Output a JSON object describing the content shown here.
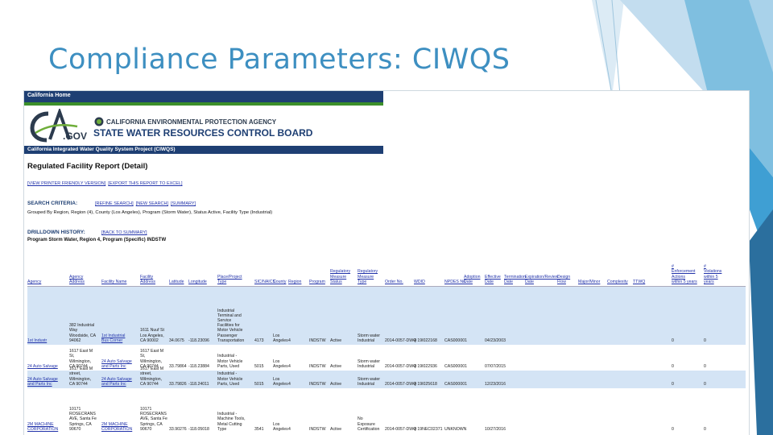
{
  "slide": {
    "title": "Compliance Parameters: CIWQS"
  },
  "site": {
    "home_bar": "California Home",
    "logo_text": "CA.GOV",
    "agency": "CALIFORNIA ENVIRONMENTAL PROTECTION AGENCY",
    "board": "STATE WATER RESOURCES CONTROL BOARD",
    "project_bar": "California Integrated Water Quality System Project (CIWQS)"
  },
  "report": {
    "title": "Regulated Facility Report (Detail)",
    "links": [
      "[VIEW PRINTER FRIENDLY VERSION]",
      "[EXPORT THIS REPORT TO EXCEL]"
    ],
    "search_label": "SEARCH CRITERIA:",
    "search_links": [
      "[REFINE SEARCH]",
      "[NEW SEARCH]",
      "[SUMMARY]"
    ],
    "grouped_by": "Grouped By Region, Region (4), County (Los Angeles), Program (Storm Water), Status Active, Facility Type (Industrial)",
    "drilldown_label": "DRILLDOWN HISTORY:",
    "drilldown_link": "[BACK TO SUMMARY]",
    "program_line": "Program Storm Water, Region 4, Program (Specific) INDSTW"
  },
  "table": {
    "headers": [
      "Agency",
      "Agency\nAddress",
      "Facility Name",
      "Facility\nAddress",
      "Latitude",
      "Longitude",
      "Place/Project\nType",
      "SIC/NAICS",
      "County",
      "Region",
      "Program",
      "Regulatory\nMeasure\nStatus",
      "Regulatory\nMeasure\nType",
      "Order No.",
      "WDID",
      "NPDES No.",
      "Adoption\nDate",
      "Effective\nDate",
      "Termination\nDate",
      "Expiration/Review\nDate",
      "Design\nFlow",
      "Major/Minor",
      "Complexity",
      "TTWQ",
      "#\nEnforcement\nActions\nwithin 5 years",
      "#\nViolations\nwithin 5\nyears"
    ],
    "rows": [
      [
        "1st Industr",
        "382 Industrial\nWay\nWoodside, CA\n94062",
        "1st Industrial\nBus Corner",
        "1611 Nuuf St\nLos Angeles,\nCA 90002",
        "34.0675",
        "-118.23096",
        "Industrial\nTerminal and\nService\nFacilities for\nMotor Vehicle\nPassenger\nTransportation",
        "4173",
        "Los\nAngeles",
        "4",
        "INDSTW",
        "Active",
        "Storm water\nIndustrial",
        "2014-0057-DWQ",
        "4 19I022168",
        "CAS000001",
        "",
        "04/23/2003",
        "",
        "",
        "",
        "",
        "",
        "",
        "0",
        "0"
      ],
      [
        "24 Auto Salvage",
        "1617 East M\nSt,\nWilmington,\nCA 90744",
        "24 Auto Salvage\nand Parts Inc",
        "1617 East M\nSt,\nWilmington,\nCA 90744",
        "33.79864",
        "-118.23884",
        "Industrial -\nMotor Vehicle\nParts, Used",
        "5015",
        "Los\nAngeles",
        "4",
        "INDSTW",
        "Active",
        "Storm water\nIndustrial",
        "2014-0057-DWQ",
        "4 19I022936",
        "CAS000001",
        "",
        "07/07/2015",
        "",
        "",
        "",
        "",
        "",
        "",
        "0",
        "0"
      ],
      [
        "24 Auto Salvage\nand Parts Inc",
        "1617 East M\nstreet,\nWilmington,\nCA 90744",
        "24 Auto Salvage\nand Parts Inc",
        "1617 East M\nstreet,\nWilmington,\nCA 90744",
        "33.79826",
        "-118.24011",
        "Industrial -\nMotor Vehicle\nParts, Used",
        "5015",
        "Los\nAngeles",
        "4",
        "INDSTW",
        "Active",
        "Storm water\nIndustrial",
        "2014-0057-DWQ",
        "4 19I025618",
        "CAS000001",
        "",
        "12/23/2016",
        "",
        "",
        "",
        "",
        "",
        "",
        "0",
        "0"
      ],
      [
        "2M MACHINE\nCORPORATION",
        "10171\nROSECRANS\nAVE, Santa Fe\nSprings, CA\n90670",
        "2M MACHINE\nCORPORATION",
        "10171\nROSECRANS\nAVE, Santa Fe\nSprings, CA\n90670",
        "33.90276",
        "-118.05018",
        "Industrial -\nMachine Tools,\nMetal Cutting\nType",
        "3541",
        "Los\nAngeles",
        "4",
        "INDSTW",
        "Active",
        "No\nExposure\nCertification",
        "2014-0057-DWQ",
        "4 19NEC02371",
        "UNKNOWN",
        "",
        "10/27/2016",
        "",
        "",
        "",
        "",
        "",
        "",
        "0",
        "0"
      ]
    ]
  }
}
